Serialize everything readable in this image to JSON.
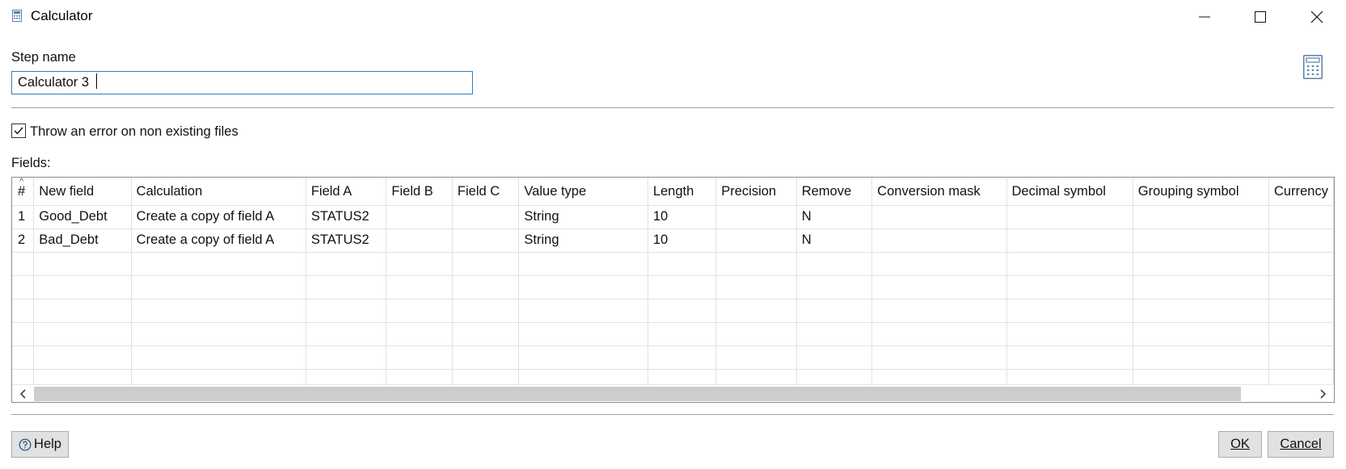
{
  "window": {
    "title": "Calculator"
  },
  "step": {
    "label": "Step name",
    "value": "Calculator 3 "
  },
  "options": {
    "throw_error_label": "Throw an error on non existing files",
    "throw_error_checked": true
  },
  "fields": {
    "label": "Fields:",
    "columns": [
      "#",
      "New field",
      "Calculation",
      "Field A",
      "Field B",
      "Field C",
      "Value type",
      "Length",
      "Precision",
      "Remove",
      "Conversion mask",
      "Decimal symbol",
      "Grouping symbol",
      "Currency"
    ],
    "rows": [
      [
        "1",
        "Good_Debt",
        "Create a copy of field A",
        "STATUS2",
        "",
        "",
        "String",
        "10",
        "",
        "N",
        "",
        "",
        "",
        ""
      ],
      [
        "2",
        "Bad_Debt",
        "Create a copy of field A",
        "STATUS2",
        "",
        "",
        "String",
        "10",
        "",
        "N",
        "",
        "",
        "",
        ""
      ]
    ],
    "empty_rows": 6,
    "sort_indicator": "^"
  },
  "footer": {
    "help_label": "Help",
    "ok_label": "OK",
    "cancel_label": "Cancel"
  },
  "icons": {
    "app": "calculator-icon",
    "minimize": "minimize-icon",
    "maximize": "maximize-icon",
    "close": "close-icon",
    "step_icon": "calculator-icon",
    "help": "question-circle-icon",
    "scroll_left": "chevron-left-icon",
    "scroll_right": "chevron-right-icon"
  },
  "colors": {
    "input_border": "#2f7fc1",
    "icon_blue": "#5b7fa7",
    "button_bg": "#e1e1e1",
    "scroll_thumb": "#cdcdcd"
  }
}
